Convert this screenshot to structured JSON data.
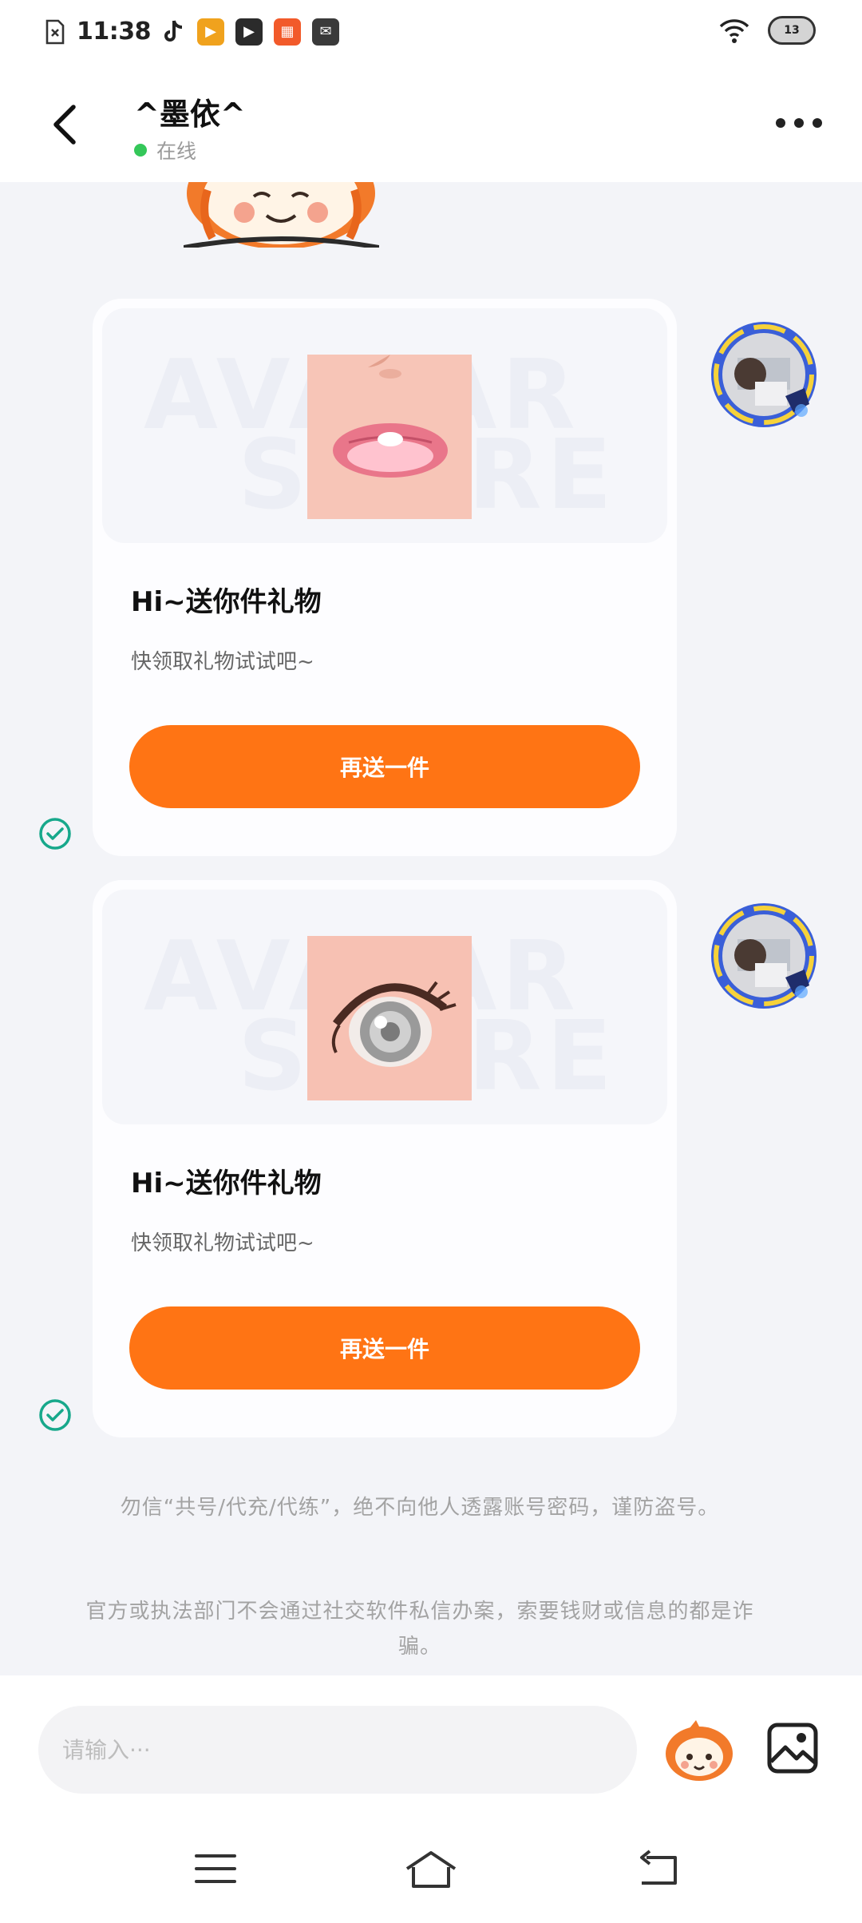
{
  "status_bar": {
    "time": "11:38",
    "battery_level": "13",
    "app_icons": [
      "file-x-icon",
      "tiktok-icon",
      "video-app-icon",
      "play-icon",
      "app-icon",
      "mail-icon"
    ]
  },
  "header": {
    "contact_name": "^墨依^",
    "status_text": "在线",
    "status_color": "#34c759"
  },
  "messages": [
    {
      "type": "gift",
      "watermark_lines": [
        "AVATAR",
        "STORE"
      ],
      "item": "lips",
      "title": "Hi~送你件礼物",
      "subtitle": "快领取礼物试试吧~",
      "button_label": "再送一件",
      "read": true
    },
    {
      "type": "gift",
      "watermark_lines": [
        "AVATAR",
        "STORE"
      ],
      "item": "eye",
      "title": "Hi~送你件礼物",
      "subtitle": "快领取礼物试试吧~",
      "button_label": "再送一件",
      "read": true
    }
  ],
  "notices": [
    "勿信“共号/代充/代练”，绝不向他人透露账号密码，谨防盗号。",
    "官方或执法部门不会通过社交软件私信办案，索要钱财或信息的都是诈骗。"
  ],
  "input": {
    "placeholder": "请输入···"
  },
  "colors": {
    "accent": "#ff7414",
    "check": "#17a88b",
    "background": "#f3f4f8"
  }
}
